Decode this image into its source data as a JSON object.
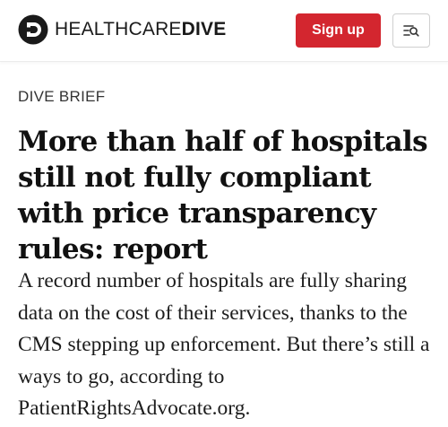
{
  "header": {
    "logo": {
      "icon": "healthcare-dive-logo-mark",
      "text_light": "HEALTHCARE",
      "text_bold": "DIVE"
    },
    "signup_label": "Sign up",
    "menu_icon": "menu-search-icon",
    "colors": {
      "signup_bg": "#d3262f",
      "signup_text": "#ffffff"
    }
  },
  "article": {
    "kicker": "DIVE BRIEF",
    "headline": "More than half of hospitals still not fully compliant with price transparency rules: report",
    "dek": "A record number of hospitals are fully sharing data on the cost of their services, thanks to the CMS stepping up enforcement. But there’s still a ways to go, according to PatientRightsAdvocate.org."
  }
}
